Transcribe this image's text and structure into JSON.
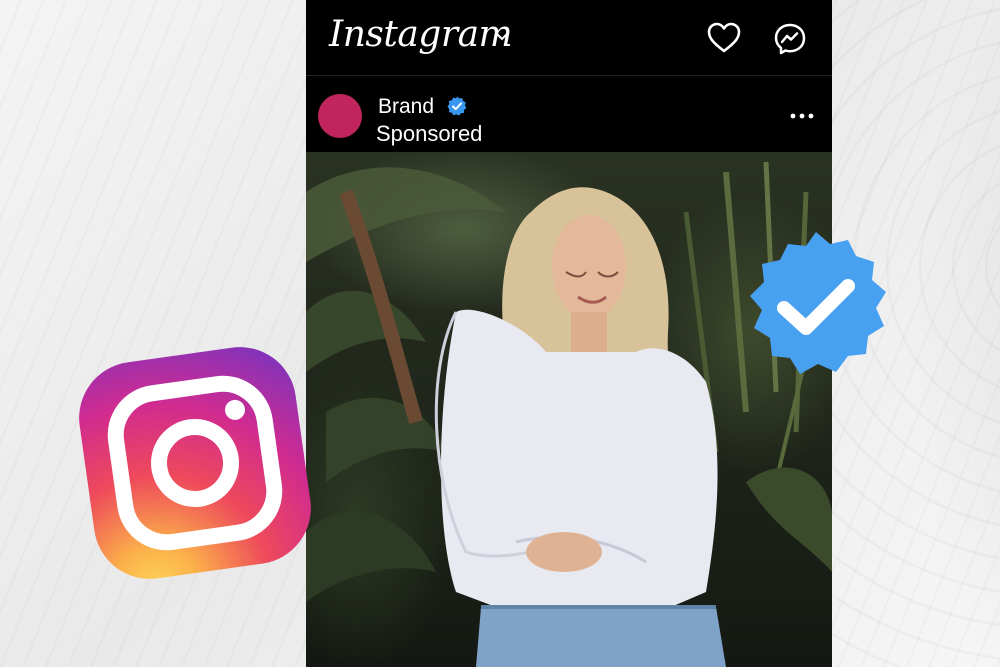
{
  "header": {
    "app_name": "Instagram",
    "icons": [
      "chevron-down-icon",
      "heart-icon",
      "messenger-icon"
    ]
  },
  "post": {
    "account_name": "Brand",
    "label": "Sponsored",
    "icons": [
      "verified-badge-icon",
      "more-options-icon"
    ]
  },
  "overlays": {
    "icons": [
      "instagram-logo-icon",
      "verified-badge-icon"
    ]
  },
  "colors": {
    "avatar": "#c2255c",
    "verified_blue": "#3897f0",
    "badge_blue": "#48a1f0",
    "phone_background": "#000000"
  }
}
